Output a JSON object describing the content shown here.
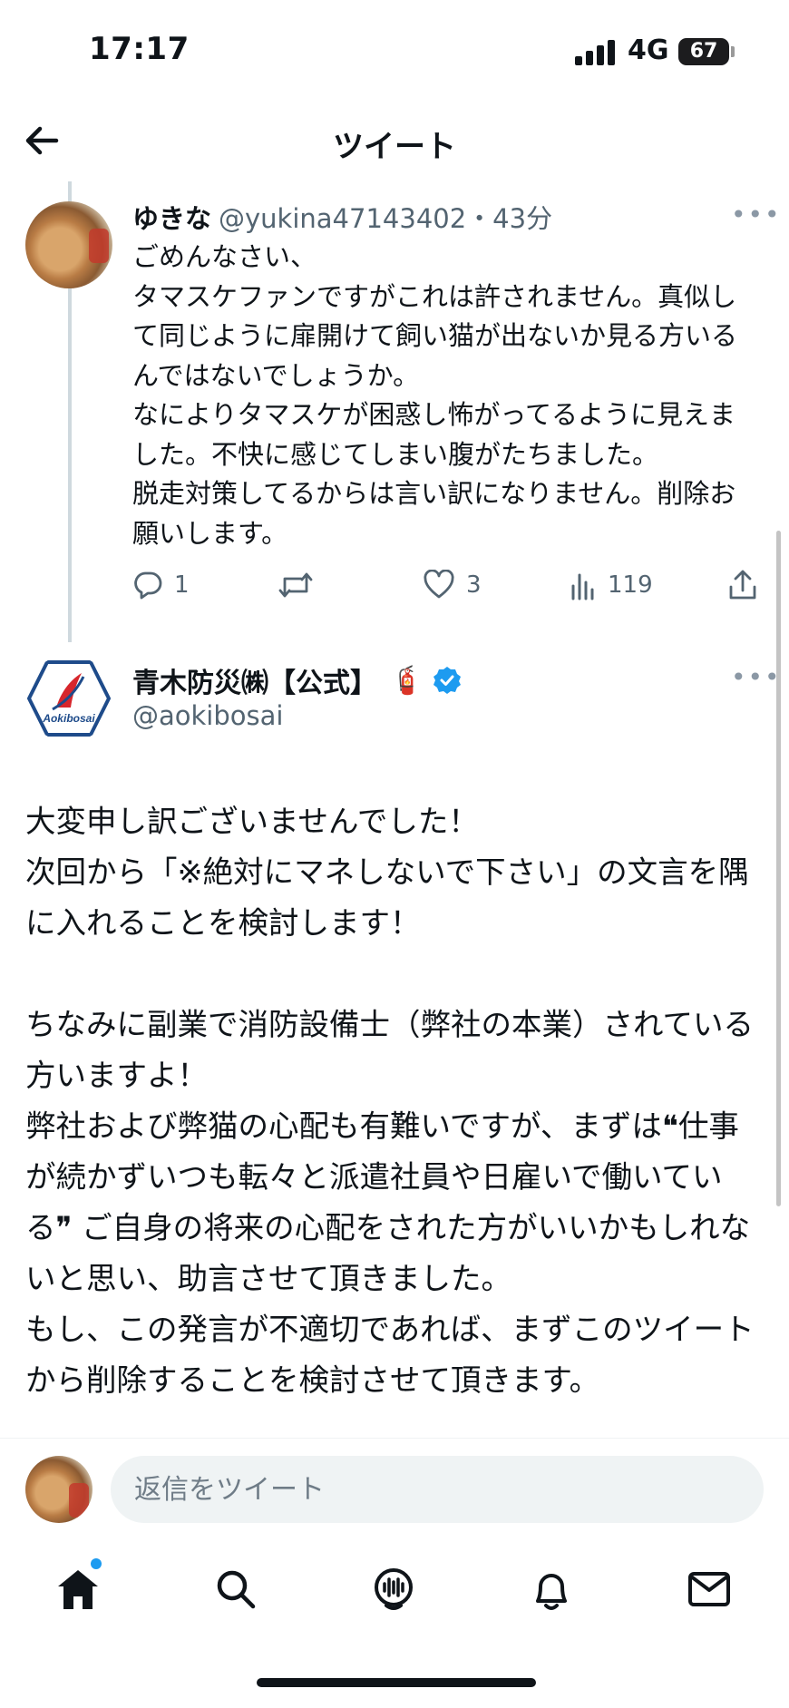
{
  "status_bar": {
    "time": "17:17",
    "network": "4G",
    "battery": "67"
  },
  "nav": {
    "title": "ツイート"
  },
  "reply_tweet": {
    "name": "ゆきな",
    "handle_time": "@yukina47143402・43分",
    "body": "ごめんなさい、\nタマスケファンですがこれは許されません。真似して同じように扉開けて飼い猫が出ないか見る方いるんではないでしょうか。\nなによりタマスケが困惑し怖がってるように見えました。不快に感じてしまい腹がたちました。\n脱走対策してるからは言い訳になりません。削除お願いします。",
    "reply_count": "1",
    "retweet_count": "",
    "like_count": "3",
    "view_count": "119"
  },
  "main_tweet": {
    "name": "青木防災㈱【公式】",
    "extinguisher_emoji": "🧯",
    "handle": "@aokibosai",
    "logo_text": "Aokibosai",
    "body": "大変申し訳ございませんでした！\n次回から「※絶対にマネしないで下さい」の文言を隅に入れることを検討します！\n\nちなみに副業で消防設備士（弊社の本業）されている方いますよ！\n弊社および弊猫の心配も有難いですが、まずは❝仕事が続かずいつも転々と派遣社員や日雇いで働いている❞ ご自身の将来の心配をされた方がいいかもしれないと思い、助言させて頂きました。\nもし、この発言が不適切であれば、まずこのツイートから削除することを検討させて頂きます。"
  },
  "reply_bar": {
    "placeholder": "返信をツイート"
  },
  "tabbar": {
    "items": [
      {
        "icon": "home-icon"
      },
      {
        "icon": "search-icon"
      },
      {
        "icon": "spaces-icon"
      },
      {
        "icon": "notifications-icon"
      },
      {
        "icon": "messages-icon"
      }
    ]
  },
  "colors": {
    "accent": "#1d9bf0",
    "muted": "#536471",
    "text": "#0f1419",
    "logo_red": "#d7262c"
  }
}
